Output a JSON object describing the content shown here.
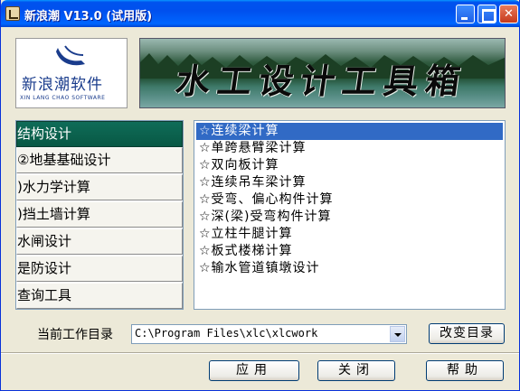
{
  "window": {
    "title": "新浪潮 V13.0 (试用版)",
    "minimize_label": "",
    "maximize_label": "",
    "close_label": "✕"
  },
  "logo": {
    "name": "新浪潮软件",
    "subtitle": "XIN LANG CHAO SOFTWARE"
  },
  "banner": {
    "title": "水工设计工具箱"
  },
  "nav": {
    "items": [
      {
        "label": "结构设计"
      },
      {
        "label": "②地基基础设计"
      },
      {
        "label": ")水力学计算"
      },
      {
        "label": ")挡土墙计算"
      },
      {
        "label": "水闸设计"
      },
      {
        "label": "是防设计"
      },
      {
        "label": "查询工具"
      }
    ]
  },
  "list": {
    "items": [
      {
        "label": "☆连续梁计算"
      },
      {
        "label": "☆单跨悬臂梁计算"
      },
      {
        "label": "☆双向板计算"
      },
      {
        "label": "☆连续吊车梁计算"
      },
      {
        "label": "☆受弯、偏心构件计算"
      },
      {
        "label": "☆深(梁)受弯构件计算"
      },
      {
        "label": "☆立柱牛腿计算"
      },
      {
        "label": "☆板式楼梯计算"
      },
      {
        "label": "☆输水管道镇墩设计"
      }
    ]
  },
  "directory": {
    "label": "当前工作目录",
    "value": "C:\\Program Files\\xlc\\xlcwork",
    "change_button": "改变目录"
  },
  "footer": {
    "apply": "应用",
    "close": "关闭",
    "help": "帮助"
  },
  "colors": {
    "title_bar": "#0053ee",
    "nav_active": "#0f6c58",
    "selection": "#316ac5"
  }
}
